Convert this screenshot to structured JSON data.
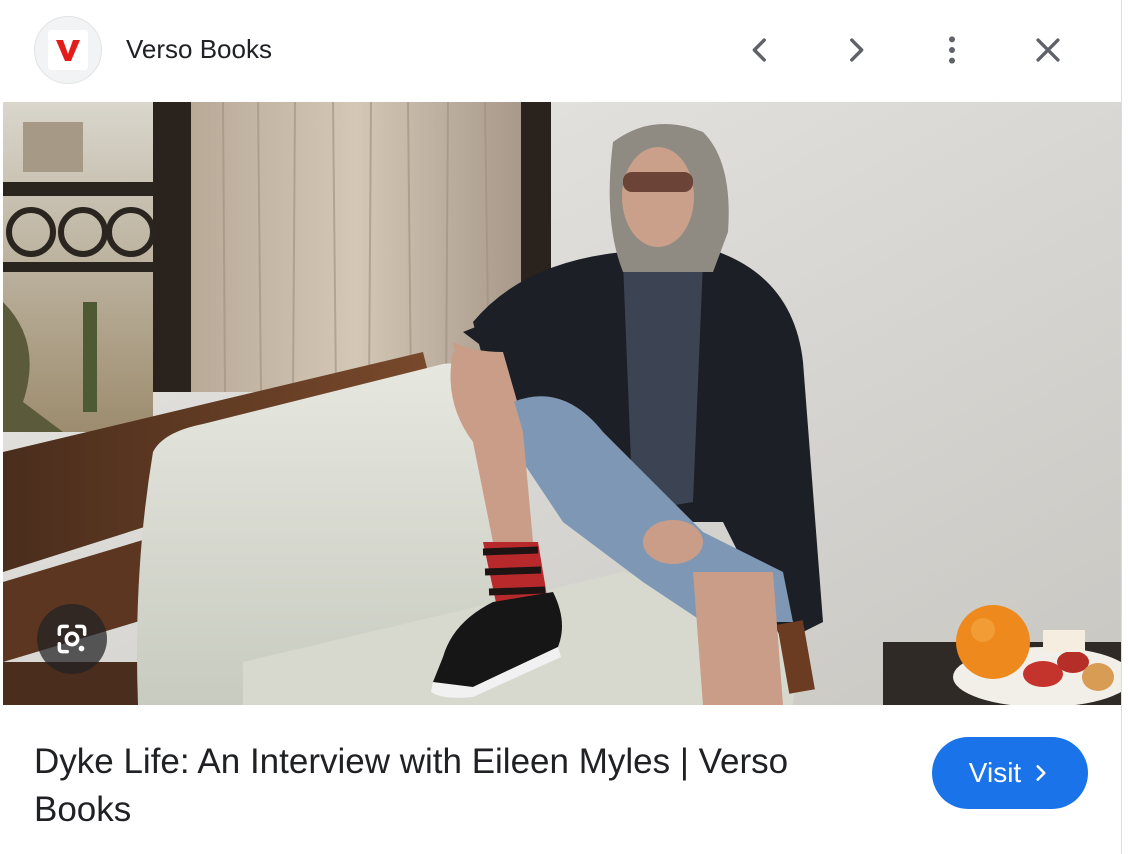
{
  "header": {
    "site_name": "Verso Books",
    "favicon": {
      "icon": "verso-v-logo",
      "color": "#e21b1b"
    },
    "buttons": [
      {
        "name": "previous",
        "icon": "chevron-left-icon"
      },
      {
        "name": "next",
        "icon": "chevron-right-icon"
      },
      {
        "name": "more",
        "icon": "more-vert-icon"
      },
      {
        "name": "close",
        "icon": "close-icon"
      }
    ]
  },
  "image": {
    "lens_button_icon": "google-lens-icon"
  },
  "result": {
    "title": "Dyke Life: An Interview with Eileen Myles | Verso Books",
    "visit_label": "Visit",
    "visit_icon": "chevron-right-icon"
  },
  "colors": {
    "accent": "#1a73e8",
    "text": "#202124",
    "icon": "#5f6368"
  }
}
